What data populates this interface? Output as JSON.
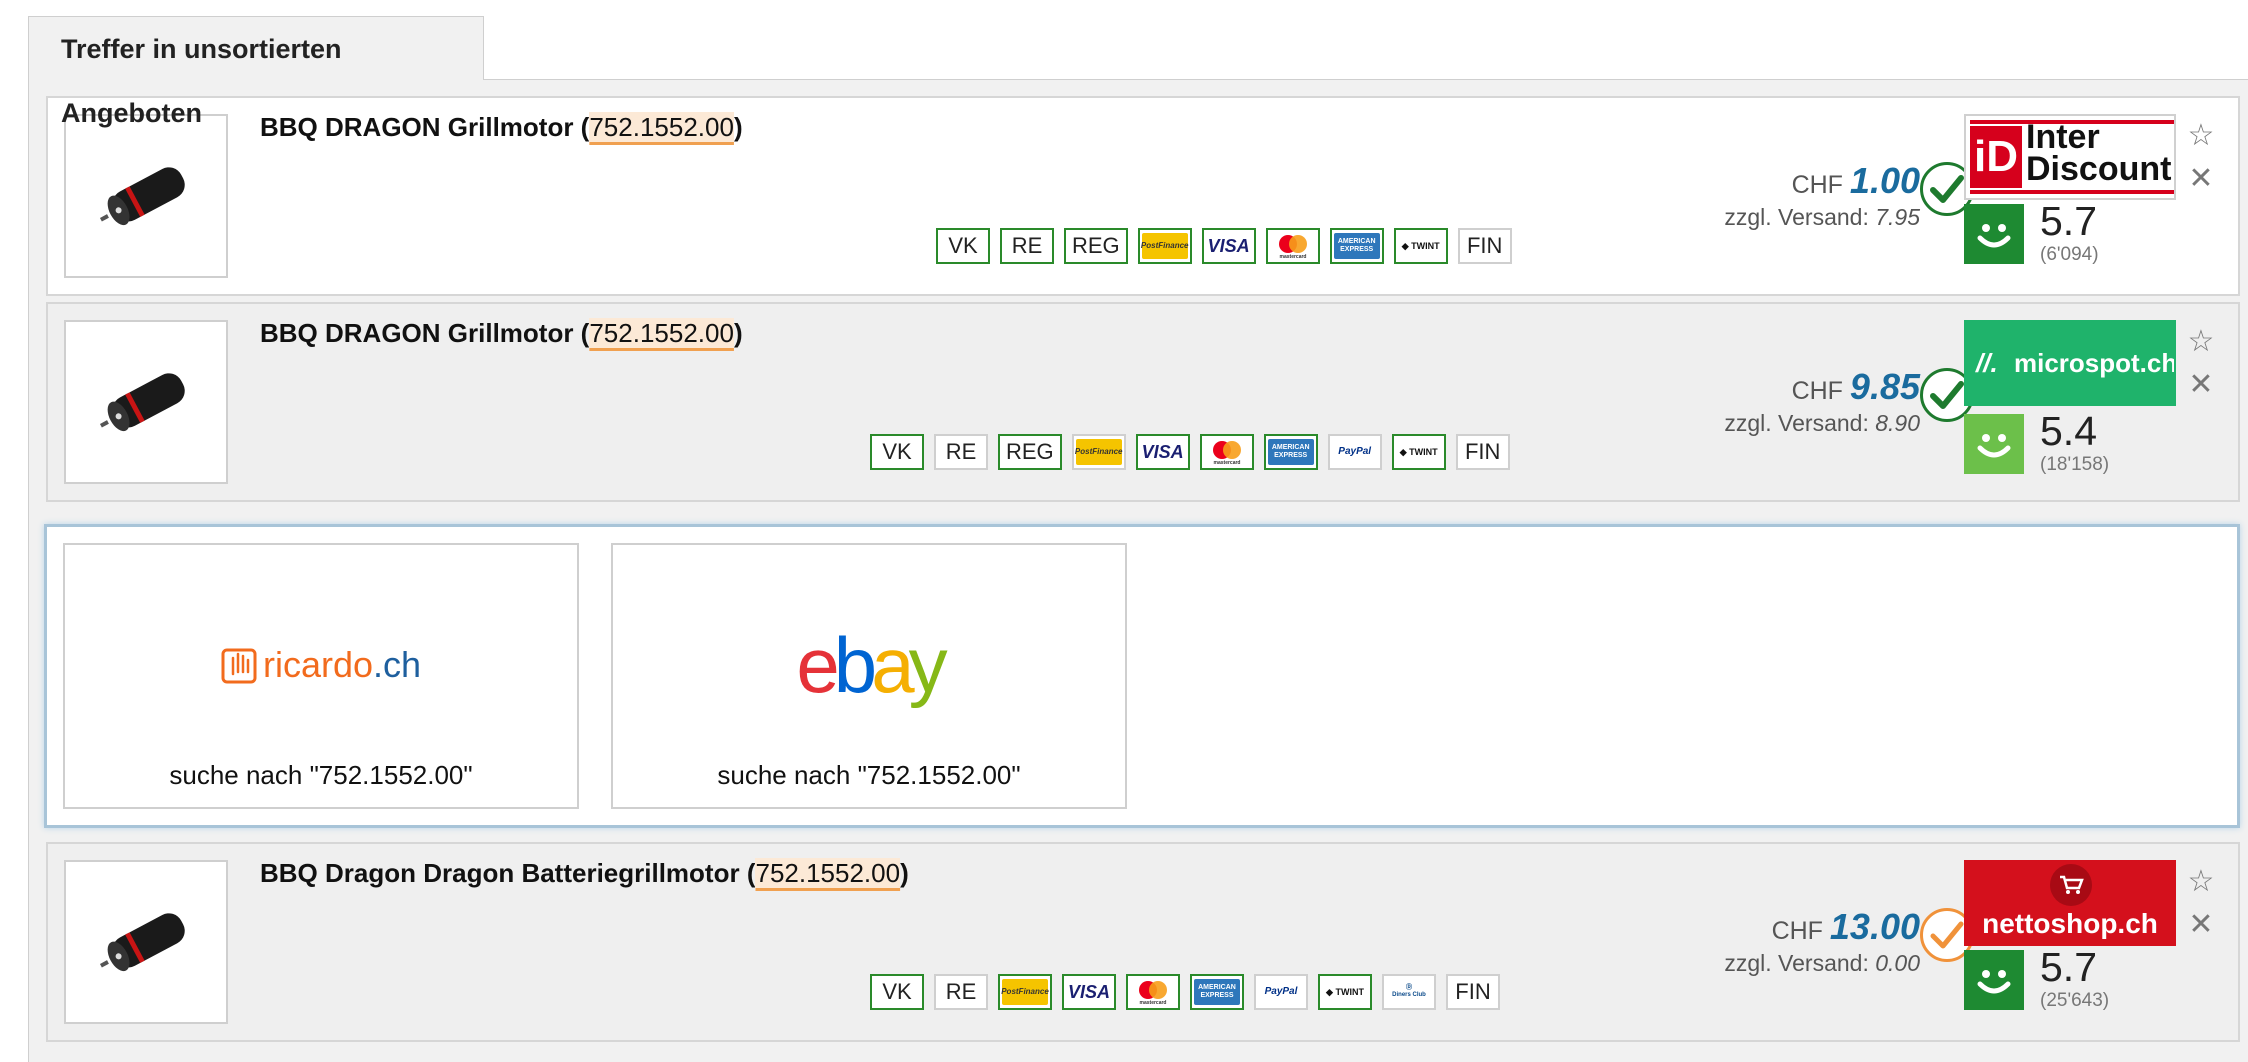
{
  "tab": {
    "label": "Treffer in unsortierten Angeboten"
  },
  "offers": [
    {
      "title_prefix": "BBQ DRAGON Grillmotor (",
      "article_code": "752.1552.00",
      "title_suffix": ")",
      "payments": [
        "VK",
        "RE",
        "REG",
        "PostFinance",
        "VISA",
        "mastercard",
        "AMERICAN EXPRESS",
        "TWINT",
        "FIN"
      ],
      "currency": "CHF",
      "price": "1.00",
      "shipping_label": "zzgl. Versand:",
      "shipping": "7.95",
      "availability": "green-check-icon",
      "shop": "Inter Discount",
      "shop_logo_text_1": "Inter",
      "shop_logo_text_2": "Discount",
      "shop_logo_mark": "iD",
      "score": "5.7",
      "reviews": "(6'094)",
      "bg": "white"
    },
    {
      "title_prefix": "BBQ DRAGON Grillmotor (",
      "article_code": "752.1552.00",
      "title_suffix": ")",
      "payments": [
        "VK",
        "RE",
        "REG",
        "PostFinance",
        "VISA",
        "mastercard",
        "AMERICAN EXPRESS",
        "PayPal",
        "TWINT",
        "FIN"
      ],
      "currency": "CHF",
      "price": "9.85",
      "shipping_label": "zzgl. Versand:",
      "shipping": "8.90",
      "availability": "green-check-icon",
      "shop": "microspot.ch",
      "shop_logo_text_1": "microspot.ch",
      "score": "5.4",
      "reviews": "(18'158)",
      "bg": "grey"
    },
    {
      "title_prefix": "BBQ Dragon Dragon Batteriegrillmotor (",
      "article_code": "752.1552.00",
      "title_suffix": ")",
      "payments": [
        "VK",
        "RE",
        "PostFinance",
        "VISA",
        "mastercard",
        "AMERICAN EXPRESS",
        "PayPal",
        "TWINT",
        "Diners Club INTERNATIONAL",
        "FIN"
      ],
      "currency": "CHF",
      "price": "13.00",
      "shipping_label": "zzgl. Versand:",
      "shipping": "0.00",
      "availability": "orange-check-icon",
      "shop": "nettoshop.ch",
      "shop_logo_text_1": "nettoshop.ch",
      "score": "5.7",
      "reviews": "(25'643)",
      "bg": "grey"
    }
  ],
  "marketplaces": [
    {
      "name": "ricardo.ch",
      "logo_a": "ricardo",
      "logo_b": ".ch",
      "caption": "suche nach \"752.1552.00\""
    },
    {
      "name": "ebay",
      "caption": "suche nach \"752.1552.00\""
    }
  ],
  "colors": {
    "price": "#1a6b9e",
    "check_green": "#1e7a2e",
    "check_orange": "#f0923a",
    "smiley_dark": "#1e8a32",
    "smiley_light": "#6cc04a",
    "interdiscount_red": "#d6001c",
    "microspot_green": "#1fb36b",
    "nettoshop_red": "#d4101c",
    "ricardo_orange": "#f26b1d",
    "ricardo_blue": "#1e5f9e"
  }
}
